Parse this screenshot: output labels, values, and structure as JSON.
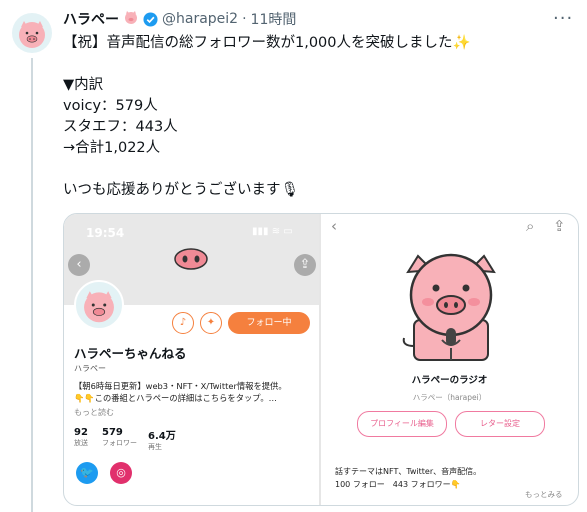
{
  "tweet": {
    "display_name": "ハラペー",
    "handle": "@harapei2",
    "separator": "·",
    "time": "11時間",
    "more": "···",
    "text": "【祝】音声配信の総フォロワー数が1,000人を突破しました✨\n\n▼内訳\nvoicy：579人\nスタエフ：443人\n→合計1,022人\n\nいつも応援ありがとうございます🎙"
  },
  "left_panel": {
    "status_time": "19:54",
    "status_icons": "▮▮▮ ≋ ▭",
    "follow_label": "フォロー中",
    "channel_name": "ハラペーちゃんねる",
    "channel_sub": "ハラペー",
    "bio": "【朝6時毎日更新】web3・NFT・X/Twitter情報を提供。\n👇👇この番組とハラペーの詳細はこちらをタップ。…",
    "bio_more": "もっと読む",
    "stats": [
      {
        "value": "92",
        "label": "放送"
      },
      {
        "value": "579",
        "label": "フォロワー"
      },
      {
        "value": "6.4万",
        "label": "再生"
      }
    ]
  },
  "right_panel": {
    "radio_name": "ハラペーのラジオ",
    "radio_sub": "ハラペー（harapei）",
    "profile_edit": "プロフィール編集",
    "letter_settings": "レター設定",
    "bio": "話すテーマはNFT、Twitter、音声配信。\n100 フォロー　443 フォロワー👇",
    "see_more": "もっとみる"
  },
  "colors": {
    "accent_orange": "#f5803e",
    "pink": "#f8b1b8",
    "twitter_blue": "#1d9bf0",
    "instagram_pink": "#e1306c"
  }
}
